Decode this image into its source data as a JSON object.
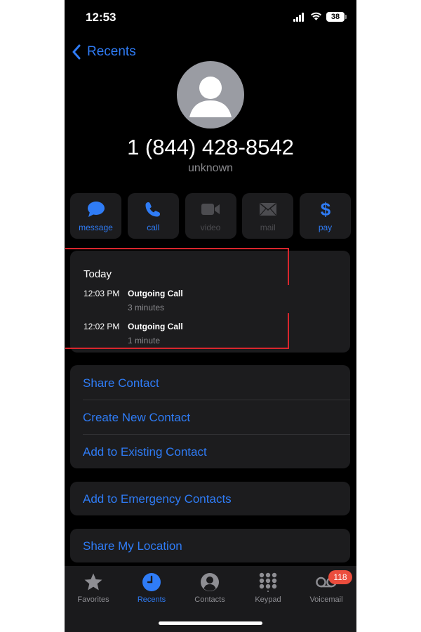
{
  "status_bar": {
    "time": "12:53",
    "battery": "38"
  },
  "nav": {
    "back_label": "Recents"
  },
  "contact": {
    "number": "1 (844) 428-8542",
    "label": "unknown"
  },
  "actions": [
    {
      "label": "message",
      "icon": "message-icon",
      "enabled": true
    },
    {
      "label": "call",
      "icon": "phone-icon",
      "enabled": true
    },
    {
      "label": "video",
      "icon": "video-icon",
      "enabled": false
    },
    {
      "label": "mail",
      "icon": "mail-icon",
      "enabled": false
    },
    {
      "label": "pay",
      "icon": "dollar-icon",
      "enabled": true
    }
  ],
  "call_log": {
    "heading": "Today",
    "entries": [
      {
        "time": "12:03 PM",
        "type": "Outgoing Call",
        "duration": "3 minutes"
      },
      {
        "time": "12:02 PM",
        "type": "Outgoing Call",
        "duration": "1 minute"
      }
    ]
  },
  "contact_actions": [
    "Share Contact",
    "Create New Contact",
    "Add to Existing Contact"
  ],
  "emergency_action": "Add to Emergency Contacts",
  "location_action": "Share My Location",
  "tab_bar": {
    "tabs": [
      {
        "label": "Favorites",
        "icon": "star-icon",
        "active": false
      },
      {
        "label": "Recents",
        "icon": "clock-icon",
        "active": true
      },
      {
        "label": "Contacts",
        "icon": "person-circle-icon",
        "active": false
      },
      {
        "label": "Keypad",
        "icon": "keypad-icon",
        "active": false
      },
      {
        "label": "Voicemail",
        "icon": "voicemail-icon",
        "active": false
      }
    ],
    "voicemail_badge": "118"
  },
  "colors": {
    "accent": "#2f7cf6",
    "background": "#000000",
    "card": "#1c1c1e",
    "badge": "#eb4d3d",
    "highlight": "#d9262d"
  }
}
